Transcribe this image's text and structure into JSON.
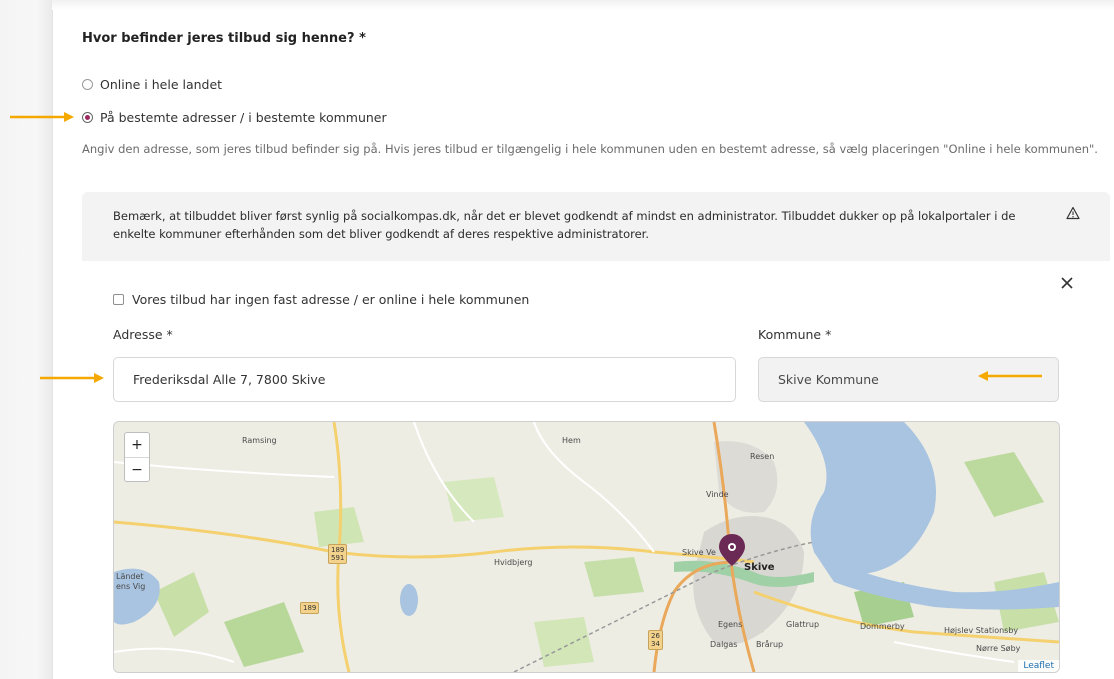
{
  "question": {
    "title": "Hvor befinder jeres tilbud sig henne? *"
  },
  "location_options": [
    {
      "label": "Online i hele landet",
      "selected": false
    },
    {
      "label": "På bestemte adresser / i bestemte kommuner",
      "selected": true
    }
  ],
  "help_text": "Angiv den adresse, som jeres tilbud befinder sig på. Hvis jeres tilbud er tilgængelig i hele kommunen uden en bestemt adresse, så vælg placeringen \"Online i hele kommunen\".",
  "notice": {
    "text": "Bemærk, at tilbuddet bliver først synlig på socialkompas.dk, når det er blevet godkendt af mindst en administrator. Tilbuddet dukker op på lokalportaler i de enkelte kommuner efterhånden som det bliver godkendt af deres respektive administratorer.",
    "icon": "warning-triangle-icon"
  },
  "address_form": {
    "no_fixed_address_label": "Vores tilbud har ingen fast adresse / er online i hele kommunen",
    "address_label": "Adresse *",
    "address_value": "Frederiksdal Alle 7, 7800 Skive",
    "kommune_label": "Kommune *",
    "kommune_value": "Skive Kommune"
  },
  "map": {
    "zoom_in": "+",
    "zoom_out": "−",
    "place_labels": [
      "Ramsing",
      "Hem",
      "Resen",
      "Vinde",
      "Skive Ve",
      "Skive",
      "Hvidbjerg",
      "Egens",
      "Glattrup",
      "Dommerby",
      "Højslev Stationsby",
      "Dalgas",
      "Brårup",
      "Nørre Søby",
      "Ländet",
      "ens Vig"
    ],
    "road_badges": [
      "189\n591",
      "189",
      "26\n34"
    ],
    "attribution": "Leaflet"
  },
  "colors": {
    "accent_arrow": "#f5a800",
    "radio_selected": "#9c2a5f",
    "marker": "#6b2a55",
    "water": "#a8c4e0"
  }
}
